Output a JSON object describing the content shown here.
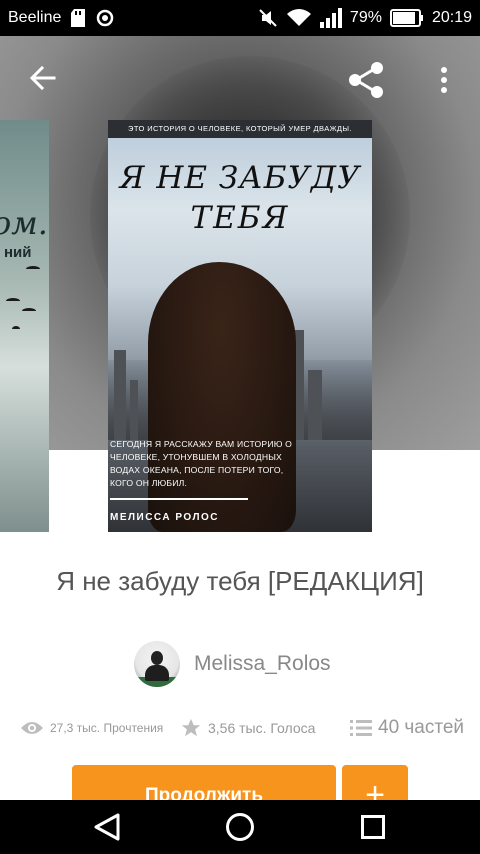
{
  "status_bar": {
    "carrier": "Beeline",
    "battery": "79%",
    "time": "20:19",
    "icons": [
      "sd-card-icon",
      "location-icon",
      "mute-icon",
      "wifi-icon",
      "signal-icon",
      "battery-icon"
    ]
  },
  "app_bar": {
    "icons": [
      "back-arrow-icon",
      "share-icon",
      "more-vert-icon"
    ]
  },
  "side_cover": {
    "title_fragment": "ом.",
    "subtitle_fragment": "ний"
  },
  "cover": {
    "tagline": "ЭТО ИСТОРИЯ О ЧЕЛОВЕКЕ, КОТОРЫЙ УМЕР ДВАЖДЫ.",
    "title_line1": "Я НЕ ЗАБУДУ",
    "title_line2": "ТЕБЯ",
    "blurb": "СЕГОДНЯ Я РАССКАЖУ ВАМ ИСТОРИЮ О ЧЕЛОВЕКЕ, УТОНУВШЕМ В ХОЛОДНЫХ ВОДАХ ОКЕАНА, ПОСЛЕ ПОТЕРИ ТОГО, КОГО ОН ЛЮБИЛ.",
    "author": "МЕЛИССА РОЛОС"
  },
  "book": {
    "title": "Я не забуду тебя [РЕДАКЦИЯ]",
    "author": "Melissa_Rolos",
    "reads": "27,3 тыс. Прочтения",
    "votes": "3,56 тыс. Голоса",
    "parts": "40 частей"
  },
  "actions": {
    "continue_label": "Продолжить",
    "add_label": "+"
  },
  "colors": {
    "accent": "#f7941d",
    "text_muted": "#999999"
  }
}
